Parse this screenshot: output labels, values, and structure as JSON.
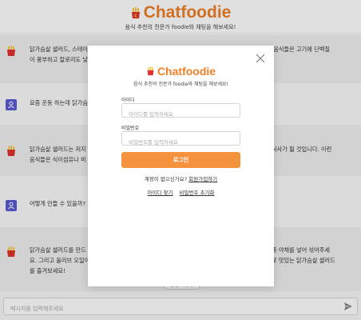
{
  "app": {
    "title": "Chatfoodie",
    "subtitle": "음식 추천의 전문가 foodie와 채팅을 해보세요!"
  },
  "messages": [
    {
      "role": "bot",
      "line1": "닭가슴살 샐러드, 스테이                                                                                          닭. 이런 음식들은 고기에 단백질",
      "line2": "이 풍부하고 칼로리도 낮"
    },
    {
      "role": "user",
      "line1": "요즘 운동 하는데 닭가슴"
    },
    {
      "role": "bot",
      "line1": "닭가슴살 샐러드는 저지                                                                                            가득한 식사가 될 것입니다. 이런",
      "line2": "음식들은 식이섬유나 비                                                                                            ."
    },
    {
      "role": "user",
      "line1": "어떻게 만들 수 있을까?"
    },
    {
      "role": "bot",
      "line1": "닭가슴살 샐러드를 만드                                                                                            등의 각종 야채를 넣어 섞어주세",
      "line2": "요. 그리고 올리브 오일이                                                                                           리법으로 맛있는 닭가슴살 샐러드",
      "line3": "를 즐겨보세요!"
    }
  ],
  "regenerate_label": "답변 재생성",
  "chat_input": {
    "placeholder": "메시지를 입력해주세요",
    "value": ""
  },
  "login_modal": {
    "title": "Chatfoodie",
    "subtitle": "음식 추천의 전문가 foodie와 채팅을 해보세요!",
    "id_label": "아이디",
    "id_placeholder": "아이디를 입력하세요",
    "pw_label": "비밀번호",
    "pw_placeholder": "비밀번호를 입력하세요",
    "login_button": "로그인",
    "no_account": "계정이 없으신가요?",
    "signup_link": "회원가입하기",
    "find_id_link": "아이디 찾기",
    "reset_pw_link": "비밀번호 초기화"
  },
  "colors": {
    "brand": "#f07f25",
    "button": "#f5923e",
    "user_avatar": "#5b5bd6"
  },
  "icons": {
    "logo": "fries-icon",
    "bot_avatar": "fries-icon",
    "user_avatar": "user-icon",
    "close": "close-icon",
    "send": "send-icon"
  }
}
